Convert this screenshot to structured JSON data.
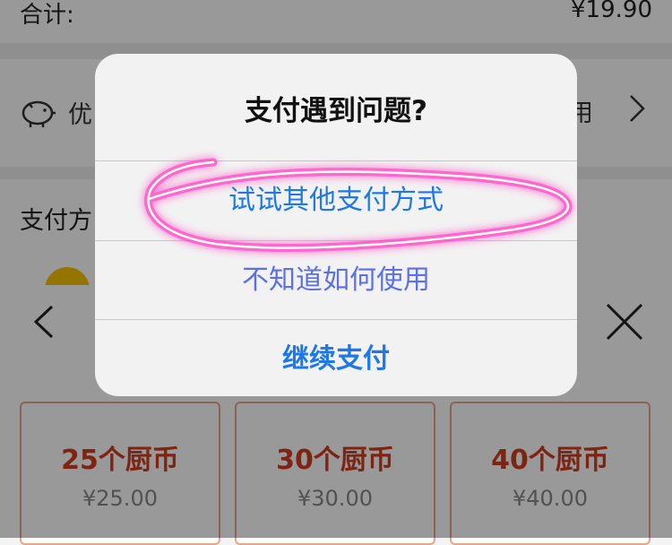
{
  "total": {
    "label": "合计:",
    "amount": "¥19.90"
  },
  "coupon": {
    "label": "优",
    "right_text": "用",
    "icon": "piggy-bank-icon"
  },
  "payment": {
    "section_label": "支付方"
  },
  "dialog": {
    "title": "支付遇到问题?",
    "options": [
      {
        "label": "试试其他支付方式",
        "highlighted": true
      },
      {
        "label": "不知道如何使用"
      },
      {
        "label": "继续支付"
      }
    ]
  },
  "sheet": {
    "back_icon": "chevron-left-icon",
    "close_icon": "close-icon",
    "packs": [
      {
        "name": "25个厨币",
        "price": "¥25.00"
      },
      {
        "name": "30个厨币",
        "price": "¥30.00"
      },
      {
        "name": "40个厨币",
        "price": "¥40.00"
      }
    ]
  },
  "colors": {
    "link": "#1e78e6",
    "accent": "#d23d1f",
    "annotation": "#ff4fc8",
    "coin": "#f6c400"
  }
}
